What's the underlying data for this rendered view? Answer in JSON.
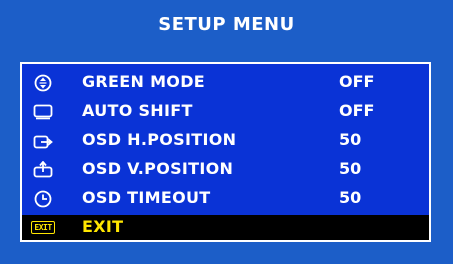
{
  "title": "SETUP MENU",
  "colors": {
    "background": "#1c5ec8",
    "menu_panel": "#0a33d6",
    "text": "#ffffff",
    "selected_row": "#000000",
    "selected_text": "#ffe600"
  },
  "items": [
    {
      "icon": "green-mode-icon",
      "label": "GREEN MODE",
      "value": "OFF"
    },
    {
      "icon": "auto-shift-icon",
      "label": "AUTO SHIFT",
      "value": "OFF"
    },
    {
      "icon": "h-position-icon",
      "label": "OSD H.POSITION",
      "value": "50"
    },
    {
      "icon": "v-position-icon",
      "label": "OSD V.POSITION",
      "value": "50"
    },
    {
      "icon": "timeout-clock-icon",
      "label": "OSD TIMEOUT",
      "value": "50"
    },
    {
      "icon": "exit-icon",
      "icon_text": "EXIT",
      "label": "EXIT",
      "selected": true
    }
  ]
}
